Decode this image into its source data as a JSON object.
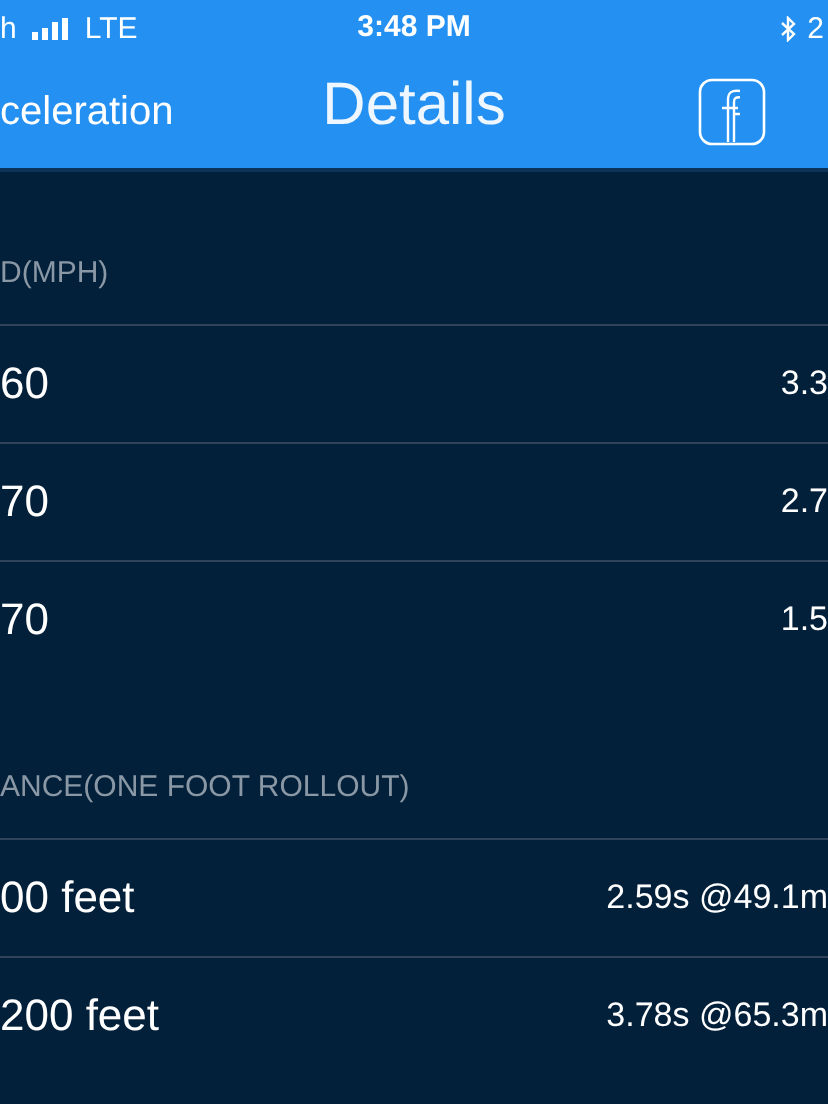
{
  "status_bar": {
    "carrier": "h",
    "network": "LTE",
    "time": "3:48 PM",
    "battery": "2"
  },
  "nav_bar": {
    "back": "celeration",
    "title": "Details"
  },
  "sections": [
    {
      "header": "D(MPH)",
      "rows": [
        {
          "label": "60",
          "value": "3.3"
        },
        {
          "label": "70",
          "value": "2.7"
        },
        {
          "label": "70",
          "value": "1.5"
        }
      ]
    },
    {
      "header": "ANCE(ONE FOOT ROLLOUT)",
      "rows": [
        {
          "label": "00 feet",
          "value": "2.59s @49.1m"
        },
        {
          "label": "200 feet",
          "value": "3.78s @65.3m"
        }
      ]
    }
  ]
}
